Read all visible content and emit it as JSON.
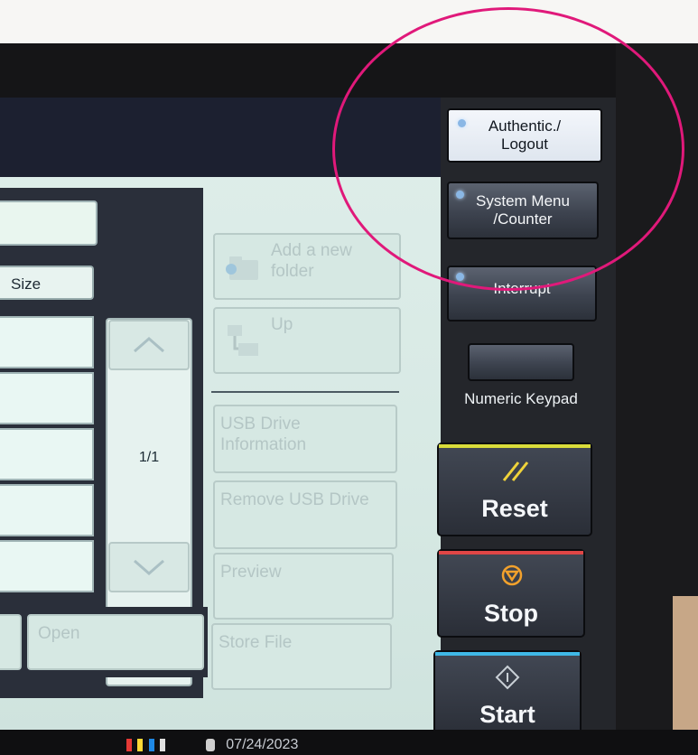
{
  "screen": {
    "list_header": {
      "size_label": "Size"
    },
    "pagination": {
      "page_indicator": "1/1"
    },
    "folder_actions": {
      "add_folder_label": "Add a new folder",
      "up_label": "Up"
    },
    "usb_actions": {
      "usb_info_label": "USB Drive Information",
      "remove_usb_label": "Remove USB Drive",
      "preview_label": "Preview",
      "store_file_label": "Store File"
    },
    "bottom": {
      "open_label": "Open"
    }
  },
  "hardware_panel": {
    "authentic_logout": "Authentic./ Logout",
    "system_menu_counter": "System Menu /Counter",
    "interrupt": "Interrupt",
    "numeric_keypad_label": "Numeric Keypad",
    "reset": "Reset",
    "stop": "Stop",
    "start": "Start"
  },
  "status_bar": {
    "date": "07/24/2023"
  },
  "colors": {
    "highlight_ring": "#e0197a",
    "reset_stripe": "#d9dc3a",
    "stop_stripe": "#e04646",
    "start_stripe": "#3fb8e6",
    "stop_icon": "#f2a12c"
  }
}
